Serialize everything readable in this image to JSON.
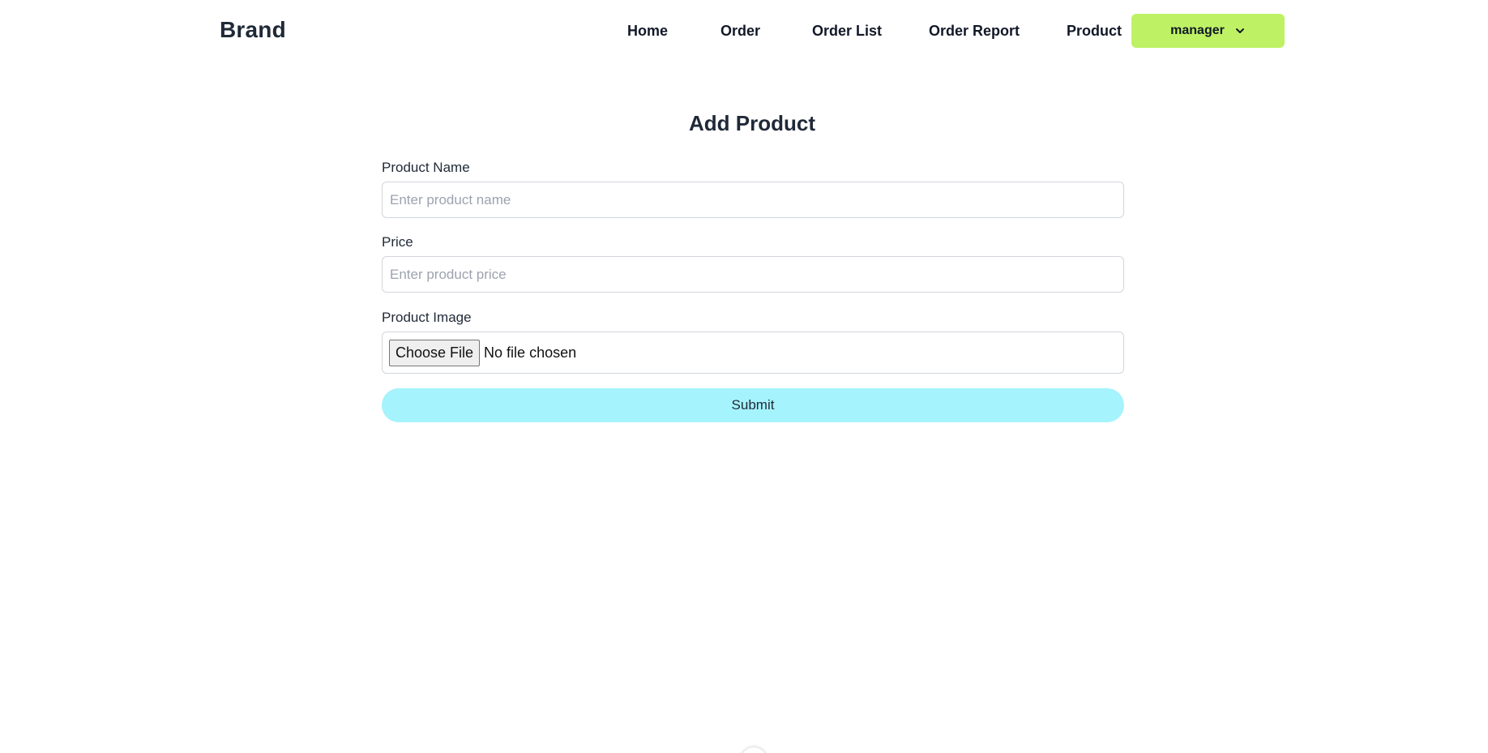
{
  "navbar": {
    "brand": "Brand",
    "links": [
      "Home",
      "Order",
      "Order List",
      "Order Report",
      "Product"
    ],
    "user": {
      "label": "manager",
      "icon": "chevron-down-icon",
      "color": "#bef264"
    }
  },
  "form": {
    "title": "Add Product",
    "product_name": {
      "label": "Product Name",
      "value": "",
      "placeholder": "Enter product name"
    },
    "price": {
      "label": "Price",
      "value": "",
      "placeholder": "Enter product price"
    },
    "image": {
      "label": "Product Image",
      "button_label": "Choose File",
      "status": "No file chosen"
    },
    "submit_label": "Submit",
    "submit_color": "#a5f3fc"
  },
  "footer": {
    "indicator_icon": "chevron-down-icon"
  }
}
